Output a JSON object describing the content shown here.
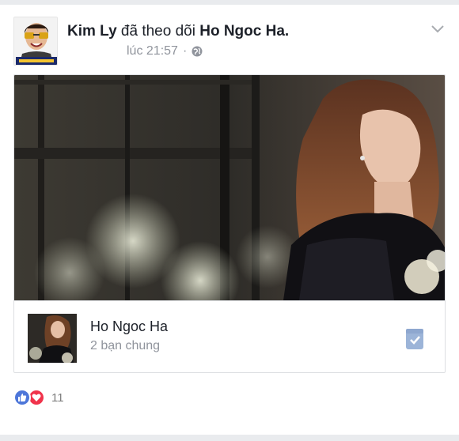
{
  "story": {
    "actor": "Kim Ly",
    "verb": "đã theo dõi",
    "target": "Ho Ngoc Ha.",
    "time": "lúc 21:57",
    "separator": "·",
    "privacy_icon": "globe-icon",
    "avatar_badge": "VESIBAIGON"
  },
  "page_card": {
    "name": "Ho Ngoc Ha",
    "mutual": "2 bạn chung",
    "follow_icon": "followed-check-icon"
  },
  "reactions": {
    "types": [
      "like",
      "love"
    ],
    "count": "11"
  },
  "colors": {
    "like": "#4d76d9",
    "love": "#f0334b",
    "meta_text": "#90949c",
    "border": "#dddfe2",
    "strip": "#e9ebee"
  }
}
